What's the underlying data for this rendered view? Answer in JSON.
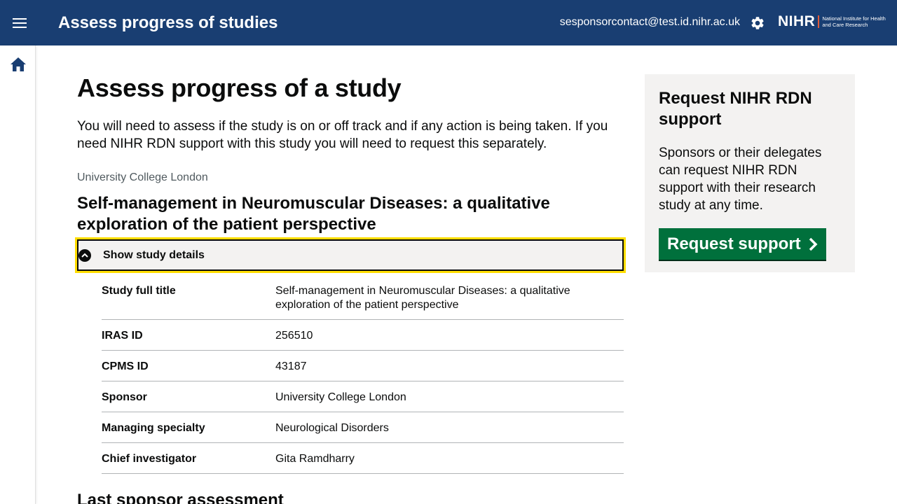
{
  "header": {
    "app_title": "Assess progress of studies",
    "user_email": "sesponsorcontact@test.id.nihr.ac.uk",
    "logo_text": "NIHR",
    "logo_subtext": "National Institute for Health and Care Research",
    "menu_icon": "hamburger-menu-icon",
    "settings_icon": "gear-icon",
    "colors": {
      "header_bg": "#193e72"
    }
  },
  "sidebar": {
    "home_icon": "home-icon"
  },
  "main": {
    "page_title": "Assess progress of a study",
    "intro": "You will need to assess if the study is on or off track and if any action is being taken. If you need NIHR RDN support with this study you will need to request this separately.",
    "organisation": "University College London",
    "study_title": "Self-management in Neuromuscular Diseases: a qualitative exploration of the patient perspective",
    "details_toggle_label": "Show study details",
    "details": [
      {
        "key": "Study full title",
        "value": "Self-management in Neuromuscular Diseases: a qualitative exploration of the patient perspective"
      },
      {
        "key": "IRAS ID",
        "value": "256510"
      },
      {
        "key": "CPMS ID",
        "value": "43187"
      },
      {
        "key": "Sponsor",
        "value": "University College London"
      },
      {
        "key": "Managing specialty",
        "value": "Neurological Disorders"
      },
      {
        "key": "Chief investigator",
        "value": "Gita Ramdharry"
      }
    ],
    "next_section_heading": "Last sponsor assessment"
  },
  "aside": {
    "title": "Request NIHR RDN support",
    "text": "Sponsors or their delegates can request NIHR RDN support with their research study at any time.",
    "button_label": "Request support",
    "colors": {
      "button_bg": "#00703c",
      "panel_bg": "#f3f2f1"
    }
  }
}
